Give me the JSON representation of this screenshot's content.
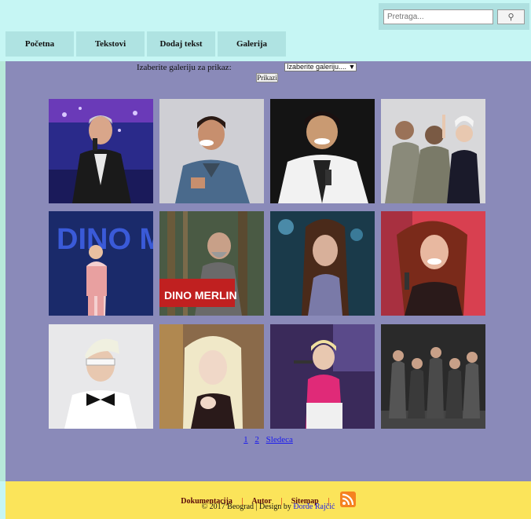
{
  "search": {
    "placeholder": "Pretraga...",
    "button_icon": "search-icon"
  },
  "nav": {
    "items": [
      {
        "label": "Početna"
      },
      {
        "label": "Tekstovi"
      },
      {
        "label": "Dodaj tekst"
      },
      {
        "label": "Galerija"
      }
    ]
  },
  "gallery_form": {
    "label": "Izaberite galeriju za prikaz:",
    "select_value": "Izaberite galeriju.... ▼",
    "submit_label": "Prikazi"
  },
  "thumbnails": [
    {
      "caption": ""
    },
    {
      "caption": ""
    },
    {
      "caption": ""
    },
    {
      "caption": ""
    },
    {
      "caption": "DINO MERLIN"
    },
    {
      "caption": "DINO MERLIN"
    },
    {
      "caption": ""
    },
    {
      "caption": ""
    },
    {
      "caption": ""
    },
    {
      "caption": ""
    },
    {
      "caption": ""
    },
    {
      "caption": ""
    }
  ],
  "pager": {
    "page1": "1",
    "page2": "2",
    "next": "Sledeca"
  },
  "footer": {
    "links": [
      "Dokumentacija",
      "Autor",
      "Sitemap"
    ],
    "separator": "|",
    "copyright_prefix": "© 2017 Beograd | Design by",
    "author": "Đorđe Rajčić"
  },
  "colors": {
    "header_bg": "#c6f6f4",
    "nav_bg": "#afe3e2",
    "main_bg": "#8a8ab9",
    "footer_bg": "#fbe45a",
    "link": "#1a1aee",
    "rss": "#f58220"
  }
}
